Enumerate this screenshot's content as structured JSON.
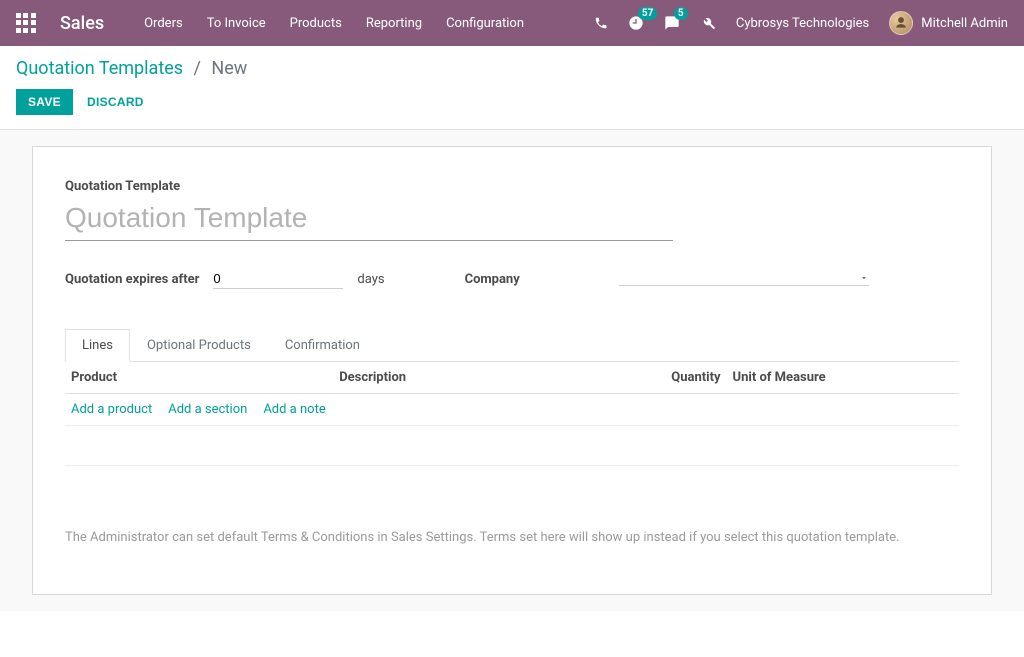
{
  "nav": {
    "brand": "Sales",
    "menu": [
      "Orders",
      "To Invoice",
      "Products",
      "Reporting",
      "Configuration"
    ],
    "badge_timer": "57",
    "badge_chat": "5",
    "company": "Cybrosys Technologies",
    "user": "Mitchell Admin"
  },
  "breadcrumb": {
    "parent": "Quotation Templates",
    "current": "New"
  },
  "actions": {
    "save": "SAVE",
    "discard": "DISCARD"
  },
  "form": {
    "title_label": "Quotation Template",
    "title_placeholder": "Quotation Template",
    "expires_label": "Quotation expires after",
    "expires_value": "0",
    "expires_unit": "days",
    "company_label": "Company",
    "company_value": "",
    "tabs": [
      "Lines",
      "Optional Products",
      "Confirmation"
    ],
    "columns": {
      "product": "Product",
      "description": "Description",
      "quantity": "Quantity",
      "uom": "Unit of Measure"
    },
    "add_links": {
      "product": "Add a product",
      "section": "Add a section",
      "note": "Add a note"
    },
    "terms_placeholder": "The Administrator can set default Terms & Conditions in Sales Settings. Terms set here will show up instead if you select this quotation template."
  }
}
